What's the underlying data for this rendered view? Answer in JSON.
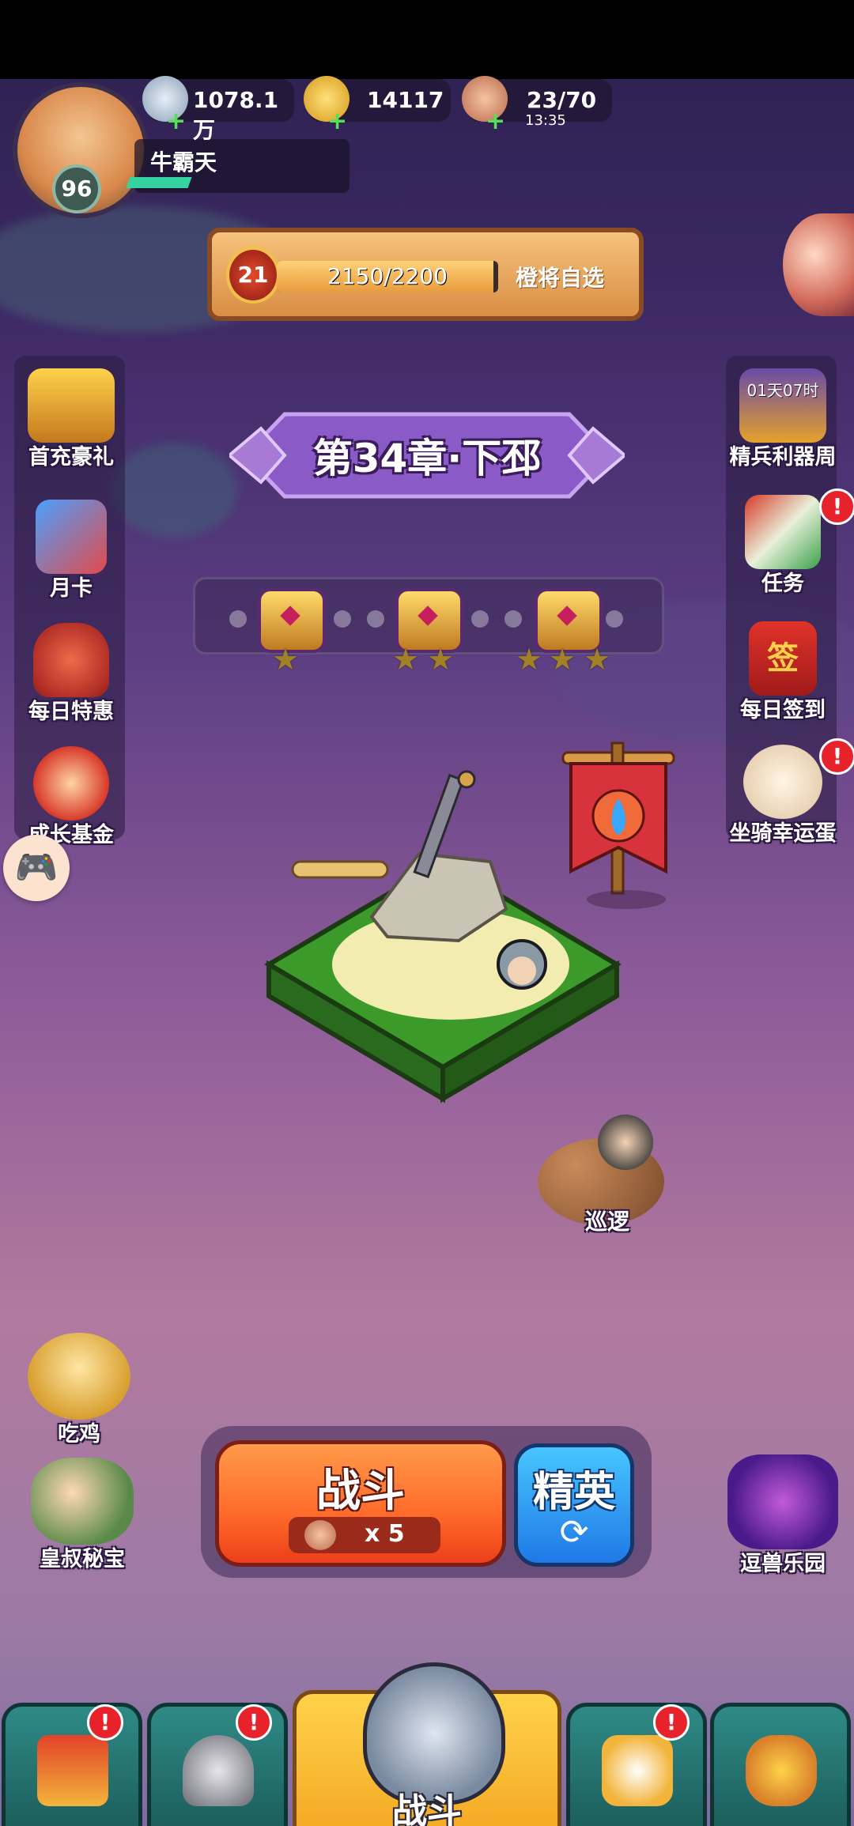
{
  "resources": {
    "silver": "1078.1万",
    "gold": "14117",
    "stamina": "23/70",
    "stamina_timer": "13:35"
  },
  "player": {
    "level": "96",
    "name": "牛霸天"
  },
  "rank_banner": {
    "badge_level": "21",
    "progress_text": "2150/2200",
    "progress_fraction": 0.977,
    "button_label": "橙将自选"
  },
  "chapter": {
    "title": "第34章·下邳"
  },
  "left_menu": [
    {
      "label": "首充豪礼",
      "icon": "treasure-chest-icon"
    },
    {
      "label": "月卡",
      "icon": "monthly-card-icon"
    },
    {
      "label": "每日特惠",
      "icon": "gift-bag-icon"
    },
    {
      "label": "成长基金",
      "icon": "fund-character-icon"
    }
  ],
  "right_menu": [
    {
      "label": "精兵利器周",
      "icon": "weapon-week-icon",
      "timer": "01天07时"
    },
    {
      "label": "任务",
      "icon": "scroll-icon",
      "alert": "!"
    },
    {
      "label": "每日签到",
      "icon": "sign-in-icon",
      "sign_char": "签"
    },
    {
      "label": "坐骑幸运蛋",
      "icon": "lucky-egg-icon",
      "alert": "!"
    }
  ],
  "progress_stars": [
    1,
    2,
    3
  ],
  "patrol_label": "巡逻",
  "bottom_left": [
    {
      "label": "吃鸡",
      "icon": "chicken-character-icon"
    },
    {
      "label": "皇叔秘宝",
      "icon": "treasure-character-icon"
    }
  ],
  "bottom_right": {
    "label": "逗兽乐园",
    "icon": "beast-park-icon"
  },
  "fight_button": {
    "label": "战斗",
    "cost": "x 5"
  },
  "elite_button": {
    "label": "精英"
  },
  "bottom_nav": [
    {
      "name": "home",
      "icon": "gate-icon",
      "alert": "!"
    },
    {
      "name": "heroes",
      "icon": "helmet-icon",
      "alert": "!"
    },
    {
      "name": "battle",
      "label": "战斗",
      "icon": "crossed-swords-icon",
      "active": true
    },
    {
      "name": "equipment",
      "icon": "stars-weapon-icon",
      "alert": "!"
    },
    {
      "name": "upgrade",
      "icon": "power-fist-icon"
    }
  ],
  "colors": {
    "accent_orange": "#ff6a2a",
    "elite_blue": "#1f78e6",
    "alert_red": "#e8222b",
    "nav_teal": "#2f8a86",
    "nav_active": "#ffd24a"
  }
}
